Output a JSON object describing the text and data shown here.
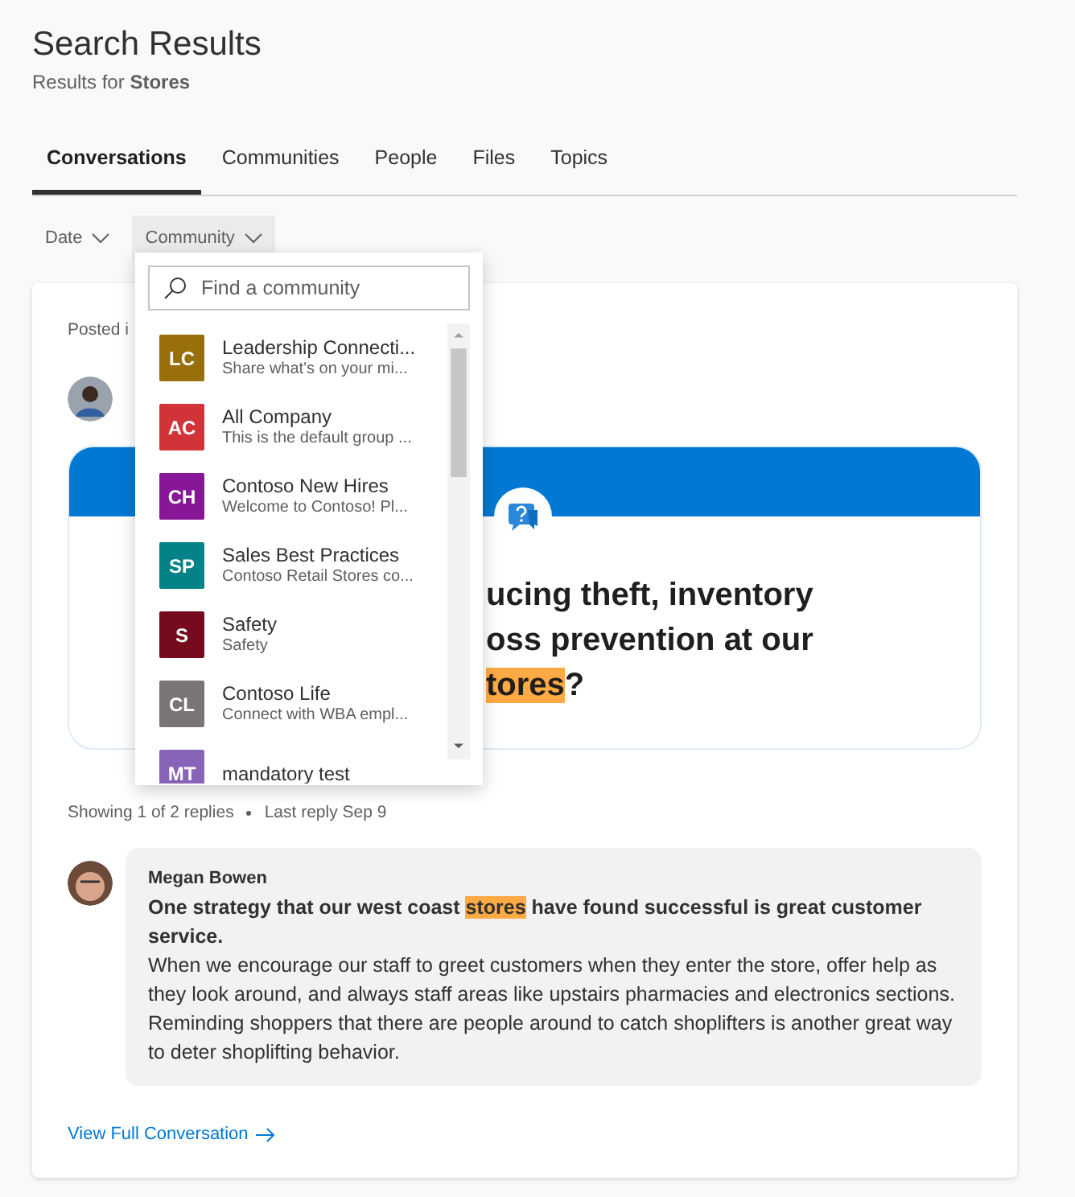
{
  "header": {
    "title": "Search Results",
    "subtitle": "Results for **Stores**"
  },
  "tabs": [
    {
      "label": "Conversations",
      "selected": true
    },
    {
      "label": "Communities",
      "selected": false
    },
    {
      "label": "People",
      "selected": false
    },
    {
      "label": "Files",
      "selected": false
    },
    {
      "label": "Topics",
      "selected": false
    }
  ],
  "filters": [
    {
      "label": "Date",
      "expanded": false
    },
    {
      "label": "Community",
      "expanded": true
    }
  ],
  "community_dropdown": {
    "search": {
      "placeholder": "Find a community"
    },
    "items": [
      {
        "initials": "LC",
        "color": "#986f0b",
        "name": "Leadership Connecti...",
        "description": "Share what's on your mi..."
      },
      {
        "initials": "AC",
        "color": "#d13438",
        "name": "All Company",
        "description": "This is the default group ..."
      },
      {
        "initials": "CH",
        "color": "#881798",
        "name": "Contoso New Hires",
        "description": "Welcome to Contoso! Pl..."
      },
      {
        "initials": "SP",
        "color": "#038387",
        "name": "Sales Best Practices",
        "description": "Contoso Retail Stores co..."
      },
      {
        "initials": "S",
        "color": "#750b1c",
        "name": "Safety",
        "description": "Safety"
      },
      {
        "initials": "CL",
        "color": "#7a7574",
        "name": "Contoso Life",
        "description": "Connect with WBA empl..."
      },
      {
        "initials": "MT",
        "color": "#8764b8",
        "name": "mandatory test"
      }
    ]
  },
  "result": {
    "posted_in": "Posted i",
    "question_lines": [
      [
        {
          "text": "ucing theft, inventory",
          "highlighted": false
        }
      ],
      [
        {
          "text": "oss prevention at our",
          "highlighted": false
        }
      ],
      [
        {
          "text": "tores",
          "highlighted": true
        },
        {
          "text": "?",
          "highlighted": false
        }
      ]
    ],
    "replies_summary": "Showing 1 of 2 replies",
    "last_reply": "Last reply Sep 9",
    "reply": {
      "author": "Megan Bowen",
      "lead": [
        {
          "text": "One strategy that our west coast ",
          "highlighted": false
        },
        {
          "text": "stores",
          "highlighted": true
        },
        {
          "text": " have found successful is great customer service.",
          "highlighted": false
        }
      ],
      "body": "When we encourage our staff to greet customers when they enter the store, offer help as they look around, and always staff areas like upstairs pharmacies and electronics sections. Reminding shoppers that there are people around to catch shoplifters is another great way to deter shoplifting behavior."
    },
    "link": "View Full Conversation"
  }
}
